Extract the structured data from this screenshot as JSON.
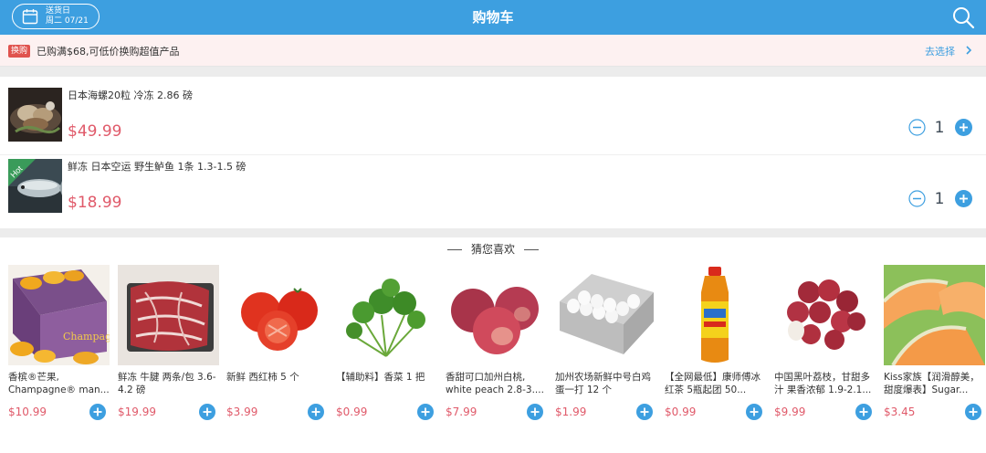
{
  "header": {
    "title": "购物车",
    "delivery_label": "送货日",
    "delivery_date": "周二 07/21"
  },
  "promo": {
    "badge": "换购",
    "text": "已购满$68,可低价换购超值产品",
    "link": "去选择"
  },
  "cart": {
    "items": [
      {
        "name": "日本海螺20粒 冷冻 2.86 磅",
        "price": "$49.99",
        "qty": "1",
        "image": "sea-snail-dish"
      },
      {
        "name": "鲜冻 日本空运 野生鲈鱼 1条 1.3-1.5 磅",
        "price": "$18.99",
        "qty": "1",
        "image": "sea-bass-fish",
        "tag": "Hot"
      }
    ]
  },
  "recommendations": {
    "title": "猜您喜欢",
    "items": [
      {
        "name": "香槟®芒果, Champagne® man...",
        "price": "$10.99",
        "image": "mango-box"
      },
      {
        "name": "鲜冻 牛腱 两条/包 3.6-4.2 磅",
        "price": "$19.99",
        "image": "beef-shank"
      },
      {
        "name": "新鲜 西红柿 5 个",
        "price": "$3.99",
        "image": "tomatoes"
      },
      {
        "name": "【辅助料】香菜 1 把",
        "price": "$0.99",
        "image": "cilantro"
      },
      {
        "name": "香甜可口加州白桃, white peach 2.8-3....",
        "price": "$7.99",
        "image": "white-peaches"
      },
      {
        "name": "加州农场新鲜中号白鸡蛋一打 12 个",
        "price": "$1.99",
        "image": "egg-carton"
      },
      {
        "name": "【全网最低】康师傅冰红茶 5瓶起团 50...",
        "price": "$0.99",
        "image": "iced-tea-bottle"
      },
      {
        "name": "中国黑叶荔枝，甘甜多汁 果香浓郁 1.9-2.1...",
        "price": "$9.99",
        "image": "lychee"
      },
      {
        "name": "Kiss家族【润滑醇美，甜度爆表】Sugar...",
        "price": "$3.45",
        "image": "cantaloupe"
      }
    ]
  },
  "colors": {
    "brand": "#3d9fe0",
    "price": "#e05a6a",
    "promo_bg": "#fdf1f1",
    "badge": "#e0534e"
  }
}
